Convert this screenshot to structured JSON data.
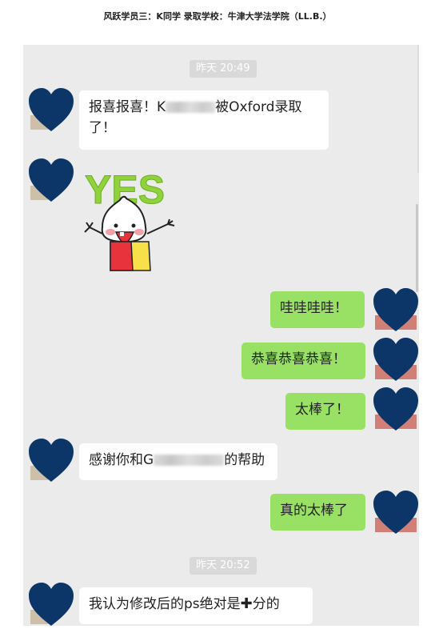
{
  "caption": "风跃学员三：K同学 录取学校：牛津大学法学院（LL.B.）",
  "chat": {
    "time1": "昨天 20:49",
    "time2": "昨天 20:52",
    "msg1_a": "报喜报喜！K",
    "msg1_b": "被Oxford录取",
    "msg1_c": "了！",
    "sticker_text": "YES",
    "msg3": "哇哇哇哇！",
    "msg4": "恭喜恭喜恭喜！",
    "msg5": "太棒了！",
    "msg6_a": "感谢你和G",
    "msg6_b": "的帮助",
    "msg7": "真的太棒了",
    "msg8_a": "我认为修改后的ps绝对是",
    "msg8_plus": "✚",
    "msg8_b": "分的"
  },
  "colors": {
    "chat_bg": "#ebebeb",
    "bubble_sent": "#98e165",
    "bubble_received": "#ffffff",
    "avatar_heart": "#0d3668"
  },
  "icons": [
    "heart-avatar-icon",
    "yes-sticker",
    "plus-icon"
  ]
}
